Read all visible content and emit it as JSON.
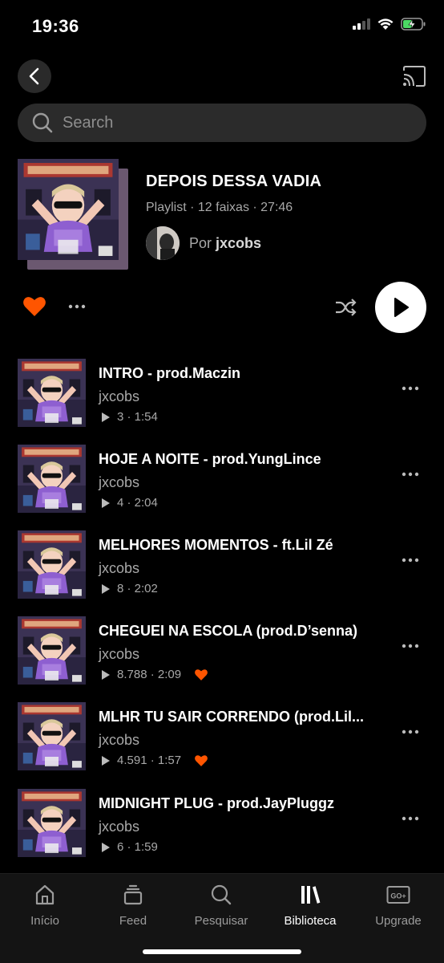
{
  "status_bar": {
    "time": "19:36"
  },
  "search": {
    "placeholder": "Search"
  },
  "playlist": {
    "title": "DEPOIS DESSA VADIA",
    "meta": "Playlist · 12 faixas · 27:46",
    "owner_prefix": "Por",
    "owner_name": "jxcobs"
  },
  "colors": {
    "accent": "#ff5500",
    "background": "#000000",
    "secondary_text": "#a8a8a8"
  },
  "tracks": [
    {
      "title": "INTRO - prod.Maczin",
      "artist": "jxcobs",
      "plays": "3",
      "duration": "1:54",
      "liked": false
    },
    {
      "title": "HOJE A NOITE - prod.YungLince",
      "artist": "jxcobs",
      "plays": "4",
      "duration": "2:04",
      "liked": false
    },
    {
      "title": "MELHORES MOMENTOS - ft.Lil Zé",
      "artist": "jxcobs",
      "plays": "8",
      "duration": "2:02",
      "liked": false
    },
    {
      "title": "CHEGUEI NA ESCOLA (prod.D’senna)",
      "artist": "jxcobs",
      "plays": "8.788",
      "duration": "2:09",
      "liked": true
    },
    {
      "title": "MLHR TU SAIR CORRENDO (prod.Lil...",
      "artist": "jxcobs",
      "plays": "4.591",
      "duration": "1:57",
      "liked": true
    },
    {
      "title": "MIDNIGHT PLUG - prod.JayPluggz",
      "artist": "jxcobs",
      "plays": "6",
      "duration": "1:59",
      "liked": false
    }
  ],
  "tabs": [
    {
      "label": "Início",
      "icon": "home-icon"
    },
    {
      "label": "Feed",
      "icon": "feed-icon"
    },
    {
      "label": "Pesquisar",
      "icon": "search-icon"
    },
    {
      "label": "Biblioteca",
      "icon": "library-icon",
      "active": true
    },
    {
      "label": "Upgrade",
      "icon": "go-plus-icon"
    }
  ]
}
